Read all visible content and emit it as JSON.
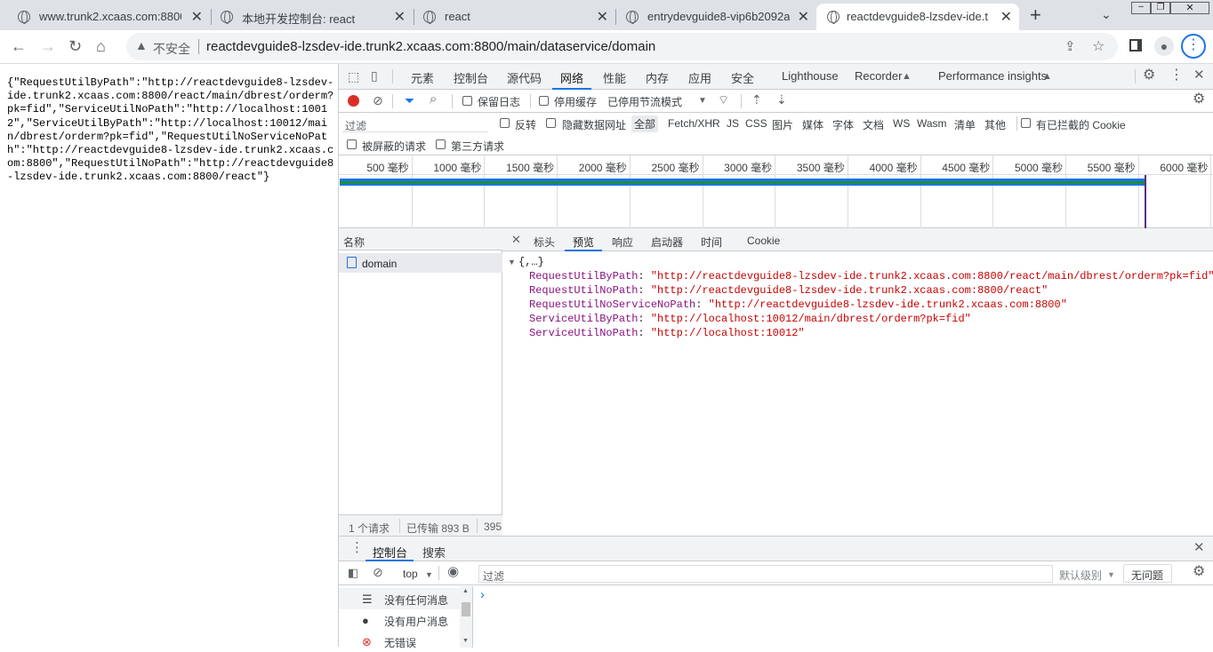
{
  "browser": {
    "tabs": [
      {
        "title": "www.trunk2.xcaas.com:8800/",
        "active": false
      },
      {
        "title": "本地开发控制台: react",
        "active": false
      },
      {
        "title": "react",
        "active": false
      },
      {
        "title": "entrydevguide8-vip6b2092a",
        "active": false
      },
      {
        "title": "reactdevguide8-lzsdev-ide.t",
        "active": true
      }
    ],
    "new_tab_label": "+",
    "insecure_label": "不安全",
    "url": "reactdevguide8-lzsdev-ide.trunk2.xcaas.com:8800/main/dataservice/domain"
  },
  "page": {
    "json_text": "{\"RequestUtilByPath\":\"http://reactdevguide8-lzsdev-ide.trunk2.xcaas.com:8800/react/main/dbrest/orderm?pk=fid\",\"ServiceUtilNoPath\":\"http://localhost:10012\",\"ServiceUtilByPath\":\"http://localhost:10012/main/dbrest/orderm?pk=fid\",\"RequestUtilNoServiceNoPath\":\"http://reactdevguide8-lzsdev-ide.trunk2.xcaas.com:8800\",\"RequestUtilNoPath\":\"http://reactdevguide8-lzsdev-ide.trunk2.xcaas.com:8800/react\"}"
  },
  "devtools": {
    "main_tabs": [
      "元素",
      "控制台",
      "源代码",
      "网络",
      "性能",
      "内存",
      "应用",
      "安全",
      "Lighthouse",
      "Recorder",
      "Performance insights"
    ],
    "active_main_tab": "网络",
    "network_toolbar": {
      "preserve_log": "保留日志",
      "disable_cache": "停用缓存",
      "throttling": "已停用节流模式"
    },
    "filter_bar": {
      "placeholder": "过滤",
      "invert": "反转",
      "hide_data_urls": "隐藏数据网址",
      "types": [
        "全部",
        "Fetch/XHR",
        "JS",
        "CSS",
        "图片",
        "媒体",
        "字体",
        "文档",
        "WS",
        "Wasm",
        "清单",
        "其他"
      ],
      "blocked_cookies": "有已拦截的 Cookie",
      "blocked_requests": "被屏蔽的请求",
      "third_party": "第三方请求"
    },
    "timeline_ticks": [
      "500 毫秒",
      "1000 毫秒",
      "1500 毫秒",
      "2000 毫秒",
      "2500 毫秒",
      "3000 毫秒",
      "3500 毫秒",
      "4000 毫秒",
      "4500 毫秒",
      "5000 毫秒",
      "5500 毫秒",
      "6000 毫秒"
    ],
    "request_list": {
      "header": "名称",
      "items": [
        "domain"
      ],
      "status": [
        "1 个请求",
        "已传输 893 B",
        "395"
      ]
    },
    "detail_tabs": [
      "标头",
      "预览",
      "响应",
      "启动器",
      "时间",
      "Cookie"
    ],
    "active_detail_tab": "预览",
    "preview": {
      "root": "{,…}",
      "entries": [
        {
          "key": "RequestUtilByPath",
          "value": "\"http://reactdevguide8-lzsdev-ide.trunk2.xcaas.com:8800/react/main/dbrest/orderm?pk=fid\""
        },
        {
          "key": "RequestUtilNoPath",
          "value": "\"http://reactdevguide8-lzsdev-ide.trunk2.xcaas.com:8800/react\""
        },
        {
          "key": "RequestUtilNoServiceNoPath",
          "value": "\"http://reactdevguide8-lzsdev-ide.trunk2.xcaas.com:8800\""
        },
        {
          "key": "ServiceUtilByPath",
          "value": "\"http://localhost:10012/main/dbrest/orderm?pk=fid\""
        },
        {
          "key": "ServiceUtilNoPath",
          "value": "\"http://localhost:10012\""
        }
      ]
    },
    "drawer": {
      "tabs": [
        "控制台",
        "搜索"
      ],
      "context": "top",
      "filter_placeholder": "过滤",
      "level": "默认级别",
      "issues": "无问题",
      "sidebar": [
        {
          "icon": "list-icon",
          "label": "没有任何消息"
        },
        {
          "icon": "user-icon",
          "label": "没有用户消息"
        },
        {
          "icon": "error-icon",
          "label": "无错误"
        }
      ],
      "prompt": "›"
    }
  },
  "colors": {
    "accent": "#1a73e8",
    "record": "#d93025",
    "json_key": "#881280",
    "json_string": "#c80000"
  }
}
